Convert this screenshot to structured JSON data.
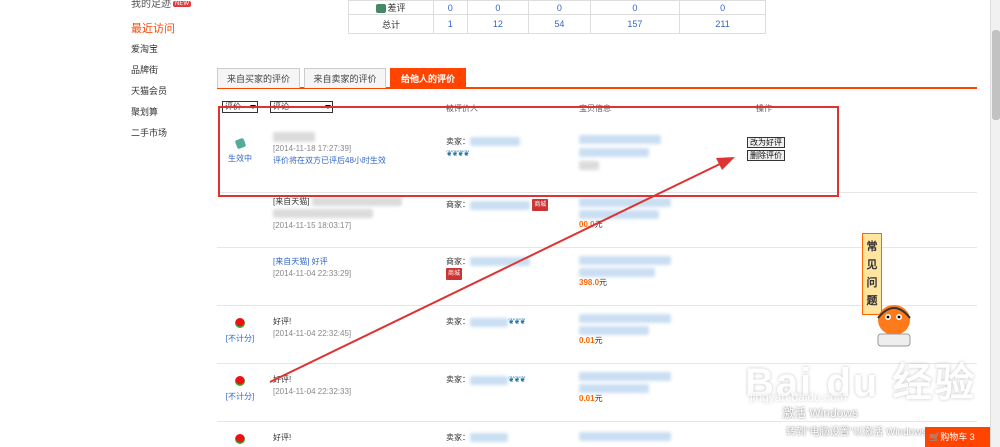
{
  "sidebar": {
    "top_item": "我的足迹",
    "new_badge": "NEW",
    "heading": "最近访问",
    "items": [
      "爱淘宝",
      "品牌街",
      "天猫会员",
      "聚划算",
      "二手市场"
    ]
  },
  "stats": {
    "bad_label": "差评",
    "bad_values": [
      "0",
      "0",
      "0",
      "0",
      "0"
    ],
    "total_label": "总计",
    "total_values": [
      "1",
      "12",
      "54",
      "157",
      "211"
    ]
  },
  "tabs": [
    {
      "label": "来自买家的评价",
      "active": false
    },
    {
      "label": "来自卖家的评价",
      "active": false
    },
    {
      "label": "给他人的评价",
      "active": true
    }
  ],
  "table_header": {
    "filter1": "评价",
    "filter2": "评论",
    "col_target": "被评价人",
    "col_goods": "宝贝信息",
    "col_ops": "操作"
  },
  "rows": [
    {
      "status": "生效中",
      "time": "[2014-11-18 17:27:39]",
      "note": "评价将在双方已评后48小时生效",
      "seller_label": "卖家：",
      "ops": [
        "改为好评",
        "删除评价"
      ]
    },
    {
      "from": "[来自天猫]",
      "time": "[2014-11-15 18:03:17]",
      "seller_label": "商家：",
      "mall_badge": "商城",
      "price": "00.0",
      "unit": "元"
    },
    {
      "from": "[来自天猫] 好评",
      "time": "[2014-11-04 22:33:29]",
      "seller_label": "商家：",
      "mall_badge": "商城",
      "price": "398.0",
      "unit": "元"
    },
    {
      "status": "[不计分]",
      "comment": "好评!",
      "time": "[2014-11-04 22:32:45]",
      "seller_label": "卖家：",
      "price": "0.01",
      "unit": "元"
    },
    {
      "status": "[不计分]",
      "comment": "好评!",
      "time": "[2014-11-04 22:32:33]",
      "seller_label": "卖家：",
      "price": "0.01",
      "unit": "元"
    },
    {
      "comment": "好评!",
      "seller_label": "卖家："
    }
  ],
  "faq": "常见问题",
  "cart": {
    "label": "购物车",
    "count": "3"
  },
  "watermark": {
    "title": "Bai du 经验",
    "sub": "jingyan.baidu.com"
  },
  "activate": {
    "line1": "激活 Windows",
    "line2": "转到\"电脑设置\"以激活 Windows。"
  },
  "colors": {
    "accent": "#ff4400",
    "annotation": "#dd3333",
    "link": "#3366cc"
  }
}
